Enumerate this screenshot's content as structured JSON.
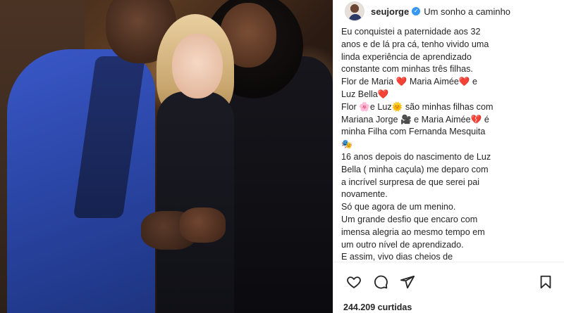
{
  "post": {
    "username": "seujorge",
    "caption_title": "Um sonho a caminho",
    "caption_lines": [
      "Eu conquistei a paternidade aos 32",
      "anos e de lá pra cá, tenho vivido uma",
      "linda experiência de aprendizado",
      "constante com minhas três filhas.",
      "Flor de Maria ❤️  Maria Aimée❤️  e",
      "Luz Bella❤️",
      "Flor 🌸e Luz🌞 são minhas filhas com",
      "Mariana Jorge 🎥 e Maria Aimée💔 é",
      "minha Filha com Fernanda Mesquita",
      "🎭",
      "16 anos depois do nascimento de Luz",
      "Bella ( minha caçula) me deparo com",
      "a incrível surpresa de que serei pai",
      "novamente.",
      "Só que agora de um menino.",
      "Um grande desfio que encaro com",
      "imensa alegria ao mesmo tempo em",
      "um outro nível de aprendizado.",
      "E assim, vivo dias cheios de"
    ],
    "likes_text": "244.209 curtidas"
  },
  "icons": {
    "like": "heart-icon",
    "comment": "comment-icon",
    "share": "share-icon",
    "save": "bookmark-icon",
    "verified": "verified-badge-icon"
  },
  "colors": {
    "text": "#262626",
    "verified": "#3897f0",
    "divider": "#efefef"
  }
}
